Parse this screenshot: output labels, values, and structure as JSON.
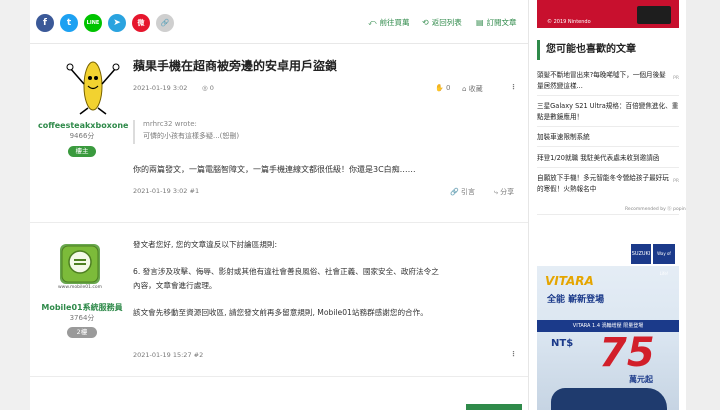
{
  "share": {
    "icons": [
      {
        "name": "facebook-share-icon",
        "glyph": "f",
        "color": "#3b5998"
      },
      {
        "name": "twitter-share-icon",
        "glyph": "t",
        "color": "#1da1f2"
      },
      {
        "name": "line-share-icon",
        "glyph": "LINE",
        "color": "#00c300"
      },
      {
        "name": "telegram-share-icon",
        "glyph": "➤",
        "color": "#2aa3df"
      },
      {
        "name": "weibo-share-icon",
        "glyph": "微",
        "color": "#e6162d"
      },
      {
        "name": "link-share-icon",
        "glyph": "🔗",
        "color": "#cfcfcf"
      }
    ],
    "prev_label": "前往買萬",
    "list_label": "返回列表",
    "subscribe_label": "訂閱文章"
  },
  "post1": {
    "username": "coffeesteakxboxone",
    "points": "9466分",
    "floor_badge": "樓主",
    "title": "蘋果手機在超商被旁邊的安卓用戶盜鎖",
    "date": "2021-01-19 3:02",
    "views": "0",
    "likes": "0",
    "collect_label": "收藏",
    "quote_author": "mrhrc32 wrote:",
    "quote_text": "可憐的小孩有這樣多疑...(恕刪)",
    "content": "你的兩篇發文，一篇電腦智障文，一篇手機連線文都很低級！你還是3C白痴……",
    "footer_meta": "2021-01-19 3:02 #1",
    "cite_label": "引言",
    "share_label": "分享"
  },
  "post2": {
    "username": "Mobile01系統服務員",
    "points": "3764分",
    "floor_badge": "2樓",
    "avatar_text": "www.mobile01.com",
    "line1": "發文者您好, 您的文章違反以下討論區規則:",
    "line2": "6. 發言涉及攻擊、侮辱、影射或其他有違社會善良風俗、社會正義、國家安全、政府法令之",
    "line3": "內容，文章會進行處理。",
    "line4": "該文會先移動至資源回收區, 請您發文前再多留意規則, Mobile01站務群感謝您的合作。",
    "footer_meta": "2021-01-19 15:27 #2"
  },
  "sidebar": {
    "top_ad_text": "© 2019 Nintendo",
    "heading": "您可能也喜歡的文章",
    "items": [
      {
        "l1": "頭髮不斷地冒出來?每晚唏噓下，一個月後髮",
        "l2": "量居然變這樣...",
        "pr": "PR"
      },
      {
        "l1": "三星Galaxy S21 Ultra規格：百倍變焦進化、重",
        "l2": "點是數鏡應用！",
        "pr": ""
      },
      {
        "l1": "加裝車速限制系統",
        "l2": "",
        "pr": ""
      },
      {
        "l1": "拜登1/20就職 我駐美代表處未收到邀請函",
        "l2": "",
        "pr": ""
      },
      {
        "l1": "自願放下手機！多元智能冬令營給孩子最好玩",
        "l2": "的寒假！火熱報名中",
        "pr": "PR"
      }
    ],
    "recommended": "Recommended by ⓑ popin",
    "ad": {
      "logo": "SUZUKI",
      "tag": "Way of Life!",
      "model": "VITARA",
      "slogan": "全能 嶄新登場",
      "banner": "VITARA 1.4 渦輪增壓 限量登場",
      "currency": "NT$",
      "price": "75",
      "unit": "萬元起"
    }
  }
}
